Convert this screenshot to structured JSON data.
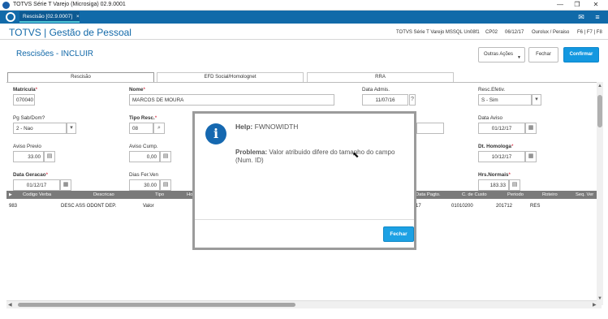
{
  "window": {
    "title": "TOTVS Série T Varejo (Microsiga) 02.9.0001",
    "controls": [
      "—",
      "❐",
      "✕"
    ]
  },
  "tabbar": {
    "app_tab": "Rescisão [02.9.0007]",
    "app_tab_close": "×"
  },
  "module": {
    "title": "TOTVS | Gestão de Pessoal",
    "server": "TOTVS Série T Varejo MSSQL Un08f1",
    "company": "CP02",
    "date": "06/12/17",
    "user": "Ourolux / Peraiso",
    "keys": "F6 | F7 | F8"
  },
  "page": {
    "title": "Rescisões - INCLUIR",
    "buttons": {
      "outras_acoes": "Outras Ações",
      "fechar": "Fechar",
      "confirmar": "Confirmar"
    }
  },
  "tabs": [
    "Rescisão",
    "EFD Social/Homolognet",
    "RRA"
  ],
  "form": {
    "matricula": {
      "label": "Matrícula",
      "value": "070040"
    },
    "nome": {
      "label": "Nome",
      "value": "MARCOS DE MOURA"
    },
    "data_admis": {
      "label": "Data Admis.",
      "value": "11/07/16"
    },
    "resc_efetiv": {
      "label": "Resc.Efetiv.",
      "value": "S - Sim"
    },
    "pg_sab_dom": {
      "label": "Pg Sab/Dom?",
      "value": "2 - Nao"
    },
    "tipo_resc": {
      "label": "Tipo Resc.",
      "value": "08"
    },
    "data_aviso": {
      "label": "Data Aviso",
      "value": "01/12/17"
    },
    "aviso_previo": {
      "label": "Aviso Previo",
      "value": "33.00"
    },
    "aviso_cump": {
      "label": "Aviso Cump.",
      "value": "0,00"
    },
    "dt_homologa": {
      "label": "Dt. Homologa",
      "value": "10/12/17"
    },
    "data_geracao": {
      "label": "Data Geracao",
      "value": "01/12/17"
    },
    "dias_fer_ven": {
      "label": "Dias Fer.Ven",
      "value": "30.00"
    },
    "hrs_normais": {
      "label": "Hrs.Normais",
      "value": "183.33"
    }
  },
  "grid": {
    "columns": [
      "Codigo Verba",
      "Descricao",
      "Tipo",
      "Ho",
      "Data Pagto.",
      "C. de Custo",
      "Periodo",
      "Roteiro",
      "Seq. Ver"
    ],
    "row": {
      "codigo": "983",
      "descricao": "DESC ASS ODONT DEP.",
      "tipo": "Valor",
      "data_pagto": "17",
      "c_custo": "01010200",
      "periodo": "201712",
      "roteiro": "RES"
    }
  },
  "dialog": {
    "title_prefix": "Help:",
    "title_value": "FWNOWIDTH",
    "msg_prefix": "Problema:",
    "msg_text": "Valor atribuido difere do tamanho do campo (Num. ID)",
    "button": "Fechar"
  }
}
